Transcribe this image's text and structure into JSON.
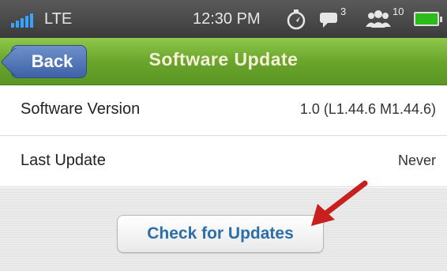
{
  "status_bar": {
    "network": "LTE",
    "time": "12:30 PM",
    "messages_count": "3",
    "contacts_count": "10",
    "icons": [
      "signal-bars-icon",
      "compass-icon",
      "message-bubble-icon",
      "contacts-icon",
      "battery-icon"
    ]
  },
  "nav": {
    "back_label": "Back",
    "title": "Software Update"
  },
  "rows": [
    {
      "label": "Software Version",
      "value": "1.0 (L1.44.6 M1.44.6)"
    },
    {
      "label": "Last Update",
      "value": "Never"
    }
  ],
  "action": {
    "check_label": "Check for Updates"
  },
  "colors": {
    "nav_green": "#6aa52c",
    "back_blue": "#3f63a8",
    "button_text": "#2b6fa8",
    "arrow_red": "#c8201e"
  }
}
